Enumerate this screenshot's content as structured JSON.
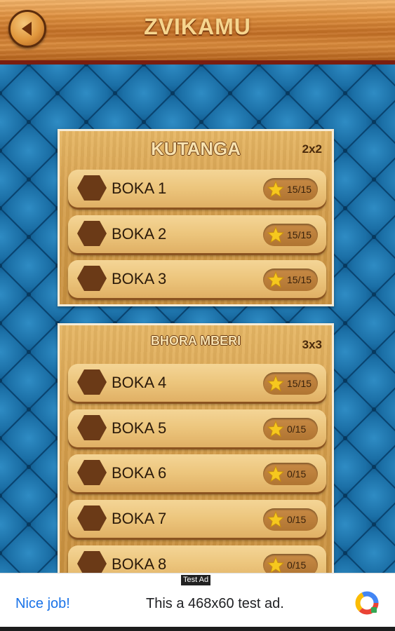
{
  "header": {
    "title": "ZVIKAMU"
  },
  "panels": [
    {
      "title": "KUTANGA",
      "size": "2x2",
      "levels": [
        {
          "label": "BOKA 1",
          "score": "15/15"
        },
        {
          "label": "BOKA 2",
          "score": "15/15"
        },
        {
          "label": "BOKA 3",
          "score": "15/15"
        }
      ]
    },
    {
      "title": "BHORA MBERI",
      "size": "3x3",
      "levels": [
        {
          "label": "BOKA 4",
          "score": "15/15"
        },
        {
          "label": "BOKA 5",
          "score": "0/15"
        },
        {
          "label": "BOKA 6",
          "score": "0/15"
        },
        {
          "label": "BOKA 7",
          "score": "0/15"
        },
        {
          "label": "BOKA 8",
          "score": "0/15"
        }
      ]
    }
  ],
  "ad": {
    "tag": "Test Ad",
    "left_text": "Nice job!",
    "text": "This a 468x60 test ad."
  },
  "colors": {
    "background": "#0f5f93",
    "wood": "#d6a04e",
    "hexagon": "#6b3a17",
    "star": "#f6c81e"
  }
}
